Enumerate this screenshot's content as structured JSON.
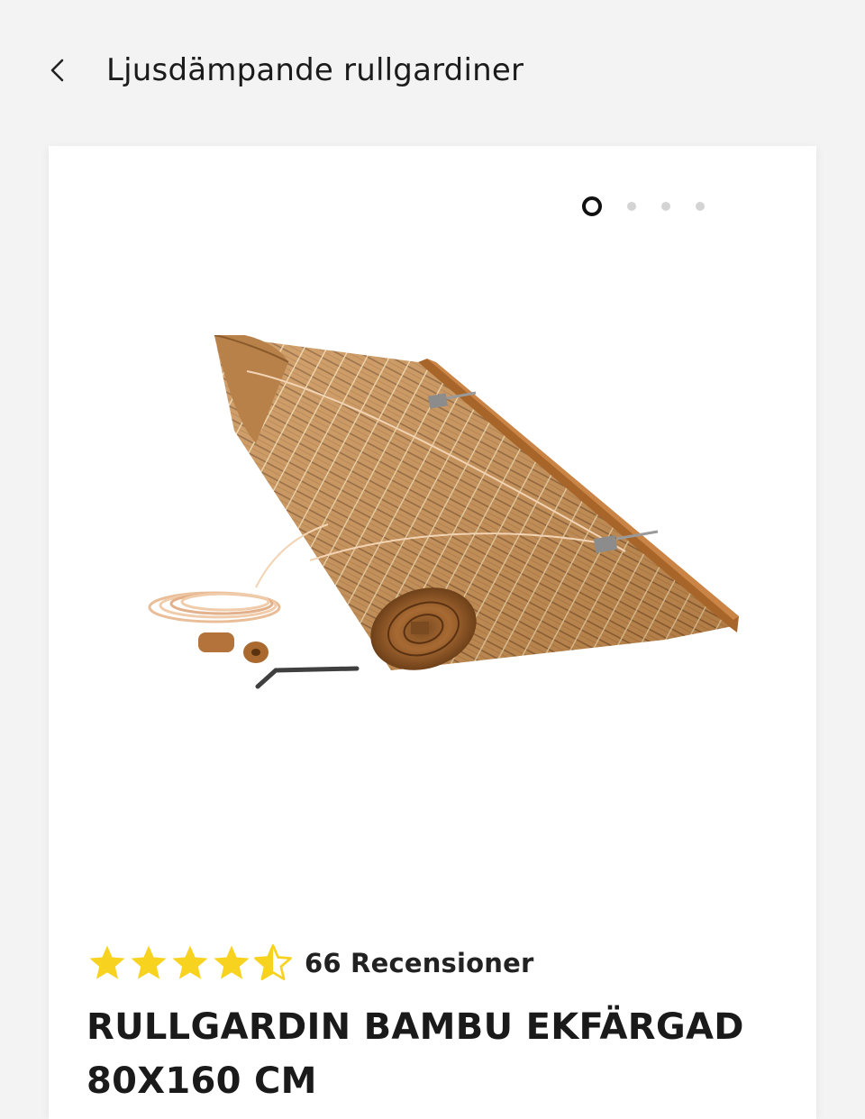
{
  "header": {
    "back_icon": "chevron-left-icon",
    "title": "Ljusdämpande rullgardiner"
  },
  "gallery": {
    "total_images": 4,
    "active_index": 0
  },
  "product": {
    "image_icon": "bamboo-roller-blind-image",
    "rating": 4.5,
    "rating_max": 5,
    "review_count_label": "66 Recensioner",
    "name": "RULLGARDIN BAMBU EKFÄRGAD 80X160 CM"
  },
  "colors": {
    "background": "#f3f3f3",
    "card": "#ffffff",
    "star": "#f7d21e",
    "dot_inactive": "#d4d4d4",
    "dot_active": "#111111"
  }
}
